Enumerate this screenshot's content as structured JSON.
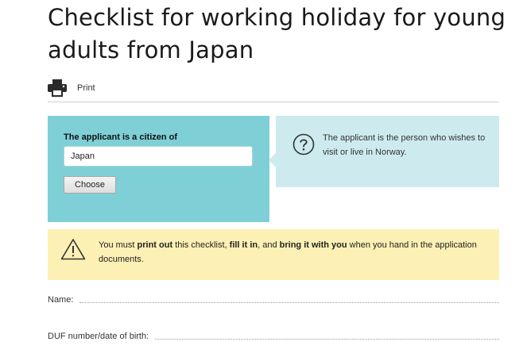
{
  "page": {
    "title": "Checklist for working holiday for young adults from Japan"
  },
  "print": {
    "label": "Print",
    "icon": "printer-icon"
  },
  "citizen": {
    "label": "The applicant is a citizen of",
    "value": "Japan",
    "button_label": "Choose"
  },
  "info": {
    "icon": "question-icon",
    "text": "The applicant is the person who wishes to visit or live in Norway."
  },
  "warning": {
    "icon": "warning-icon",
    "text_1": "You must ",
    "bold_1": "print out",
    "text_2": " this checklist, ",
    "bold_2": "fill it in",
    "text_3": ", and ",
    "bold_3": "bring it with you",
    "text_4": " when you hand in the application documents."
  },
  "form": {
    "fields": [
      {
        "label": "Name:"
      },
      {
        "label": "DUF number/date of birth:"
      }
    ]
  },
  "colors": {
    "citizen_bg": "#7ed0d6",
    "info_bg": "#cdebee",
    "warning_bg": "#fcf0b4"
  }
}
